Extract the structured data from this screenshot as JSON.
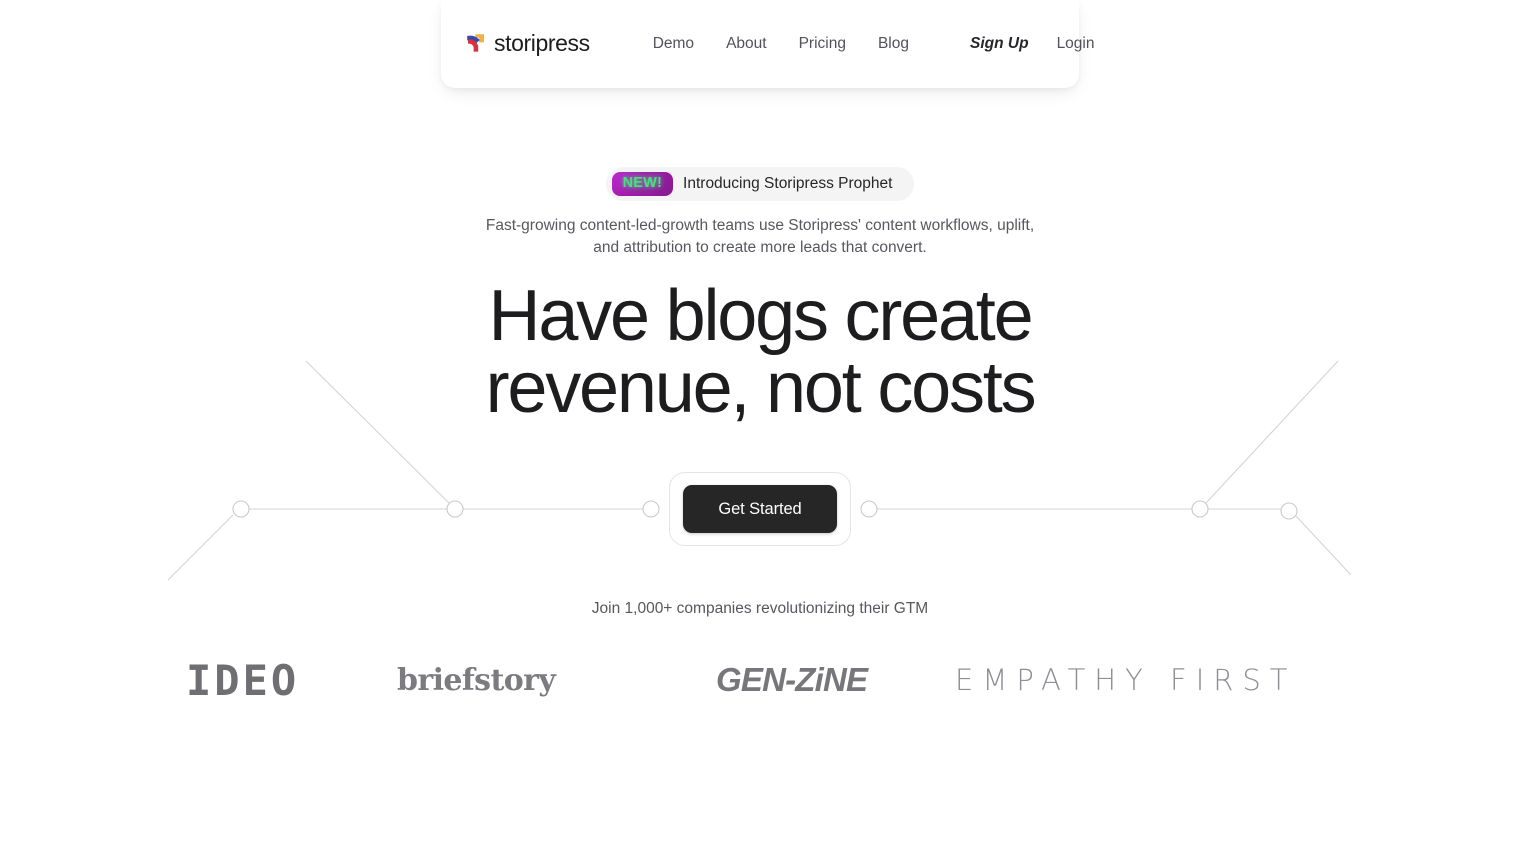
{
  "header": {
    "brand": {
      "name": "storipress",
      "logo_icon": "storipress-flag-logo",
      "colors": {
        "blue": "#3b4aa8",
        "red": "#d8323c",
        "yellow": "#f2b23c"
      }
    },
    "nav_links": [
      {
        "label": "Demo",
        "name": "nav-link-demo"
      },
      {
        "label": "About",
        "name": "nav-link-about"
      },
      {
        "label": "Pricing",
        "name": "nav-link-pricing"
      },
      {
        "label": "Blog",
        "name": "nav-link-blog"
      }
    ],
    "sign_up": "Sign Up",
    "login": "Login"
  },
  "hero": {
    "badge": {
      "tag": "NEW!",
      "label": "Introducing Storipress Prophet",
      "tag_bg_start": "#c026d3",
      "tag_bg_end": "#86198f",
      "tag_text_color": "#4ade80",
      "pill_bg": "#f4f4f5"
    },
    "subheading": "Fast-growing content-led-growth teams use Storipress' content workflows, uplift, and attribution to create more leads that convert.",
    "headline_line1": "Have blogs create",
    "headline_line2": "revenue, not costs",
    "cta_label": "Get Started",
    "cta_bg": "#262626"
  },
  "social_proof": {
    "caption": "Join 1,000+ companies revolutionizing their GTM",
    "logos": [
      {
        "name": "logo-ideo",
        "text": "IDEO"
      },
      {
        "name": "logo-briefstory",
        "text": "briefstory"
      },
      {
        "name": "logo-gen-zine",
        "text": "GEN-ZiNE"
      },
      {
        "name": "logo-empathy-first",
        "text": "EMPATHY FIRST"
      }
    ]
  },
  "decoration": {
    "line_color": "#d4d4d8",
    "node_count": 6,
    "description": "horizontal connector line with circular nodes and diagonal branches"
  }
}
